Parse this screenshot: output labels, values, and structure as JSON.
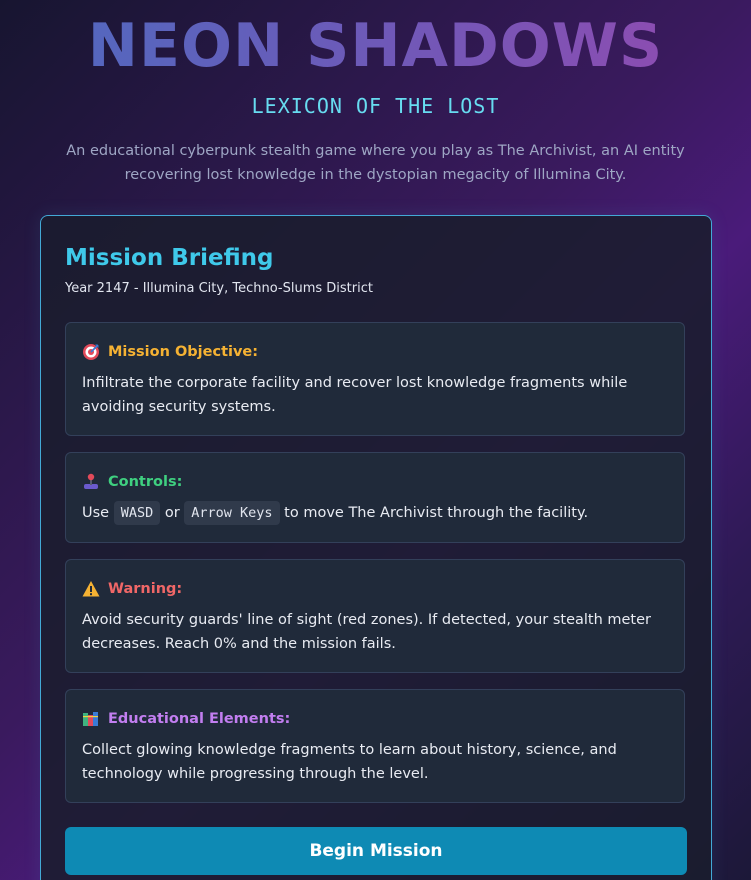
{
  "header": {
    "title": "NEON SHADOWS",
    "subtitle": "LEXICON OF THE LOST",
    "intro": "An educational cyberpunk stealth game where you play as The Archivist, an AI entity recovering lost knowledge in the dystopian megacity of Illumina City."
  },
  "briefing": {
    "title": "Mission Briefing",
    "meta": "Year 2147 - Illumina City, Techno-Slums District",
    "sections": [
      {
        "icon": "target-icon",
        "label": "Mission Objective:",
        "color": "#f5b233",
        "body": "Infiltrate the corporate facility and recover lost knowledge fragments while avoiding security systems."
      },
      {
        "icon": "joystick-icon",
        "label": "Controls:",
        "color": "#3fd080",
        "body_prefix": "Use",
        "key1": "WASD",
        "body_mid": "or",
        "key2": "Arrow Keys",
        "body_suffix": "to move The Archivist through the facility."
      },
      {
        "icon": "warning-icon",
        "label": "Warning:",
        "color": "#f06767",
        "body": "Avoid security guards' line of sight (red zones). If detected, your stealth meter decreases. Reach 0% and the mission fails."
      },
      {
        "icon": "books-icon",
        "label": "Educational Elements:",
        "color": "#c27ef0",
        "body": "Collect glowing knowledge fragments to learn about history, science, and technology while progressing through the level."
      }
    ],
    "begin_label": "Begin Mission"
  }
}
